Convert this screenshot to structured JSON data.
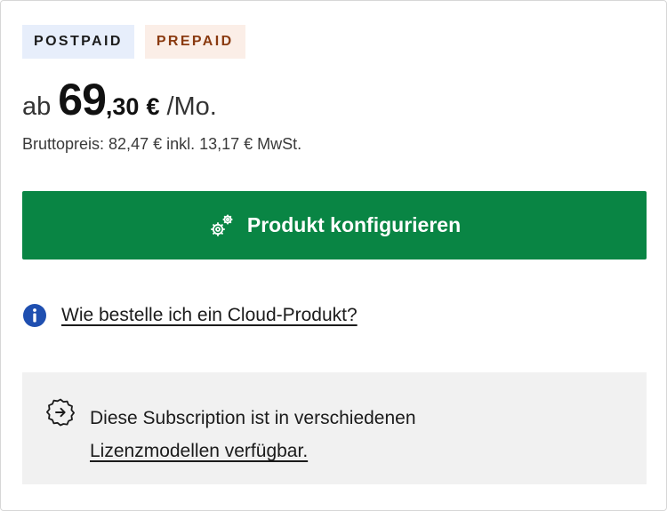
{
  "badges": {
    "postpaid": "POSTPAID",
    "prepaid": "PREPAID"
  },
  "price": {
    "prefix": "ab",
    "integer": "69",
    "decimal": ",30",
    "currency": "€",
    "period": "/Mo."
  },
  "gross_price_text": "Bruttopreis: 82,47 € inkl. 13,17 € MwSt.",
  "cta": {
    "label": "Produkt konfigurieren",
    "icon": "gears-icon"
  },
  "help": {
    "icon": "info-icon",
    "link_label": "Wie bestelle ich ein Cloud-Produkt?"
  },
  "note": {
    "icon": "badge-arrow-icon",
    "text": "Diese Subscription ist in verschiedenen",
    "link_label": "Lizenzmodellen verfügbar."
  },
  "colors": {
    "primary_green": "#098544",
    "info_blue": "#1f4fb0",
    "prepaid_text": "#8a3a10",
    "postpaid_bg": "#e7eefb",
    "prepaid_bg": "#fbeee7",
    "note_bg": "#f1f1f1"
  }
}
